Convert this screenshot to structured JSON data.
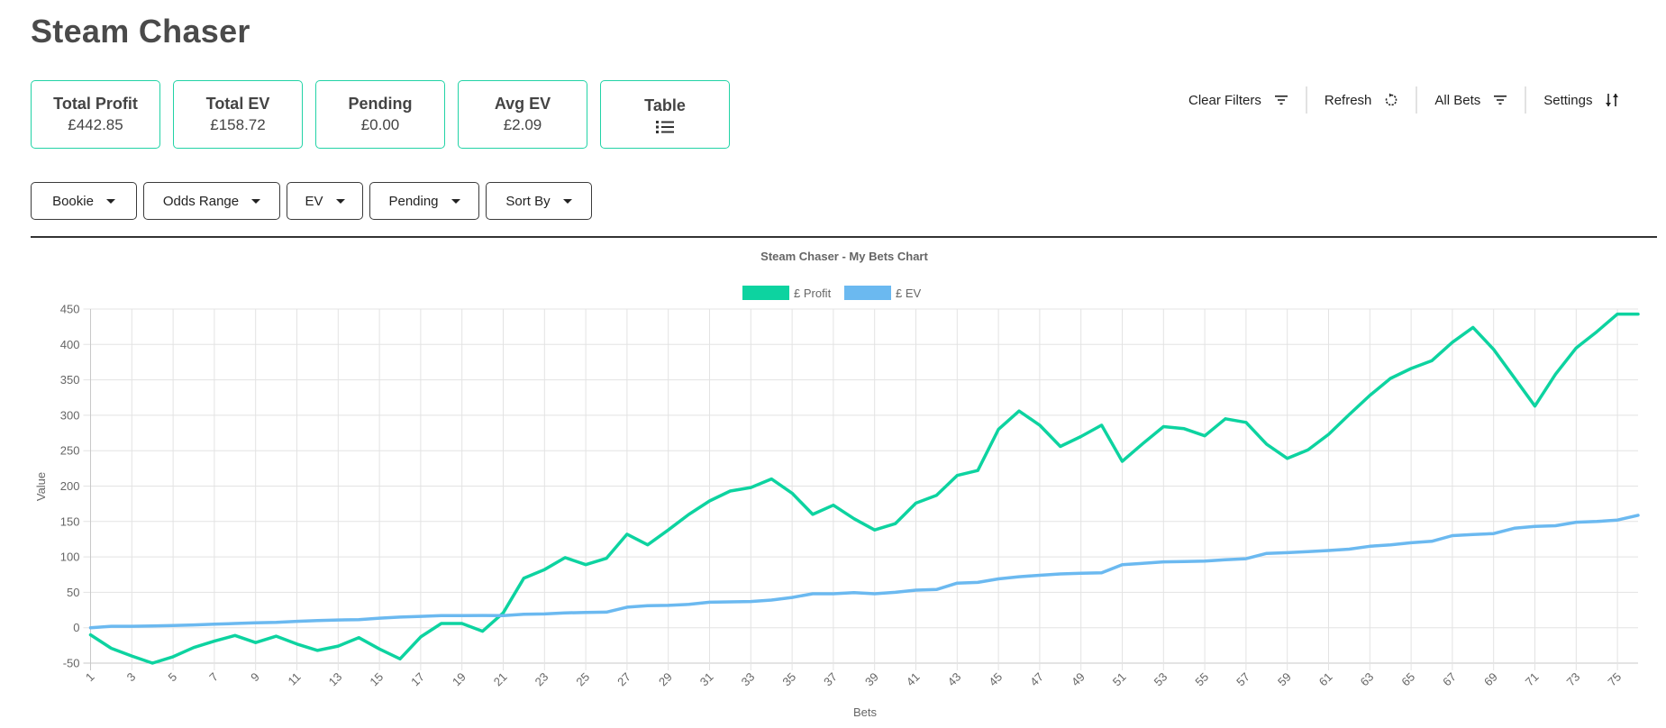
{
  "app": {
    "title": "Steam Chaser"
  },
  "cards": [
    {
      "label": "Total Profit",
      "value": "£442.85"
    },
    {
      "label": "Total EV",
      "value": "£158.72"
    },
    {
      "label": "Pending",
      "value": "£0.00"
    },
    {
      "label": "Avg EV",
      "value": "£2.09"
    },
    {
      "label": "Table",
      "icon": "list-icon"
    }
  ],
  "toolbar": [
    {
      "label": "Clear Filters",
      "icon": "filter-icon"
    },
    {
      "label": "Refresh",
      "icon": "refresh-icon"
    },
    {
      "label": "All Bets",
      "icon": "filter-icon"
    },
    {
      "label": "Settings",
      "icon": "sort-icon"
    }
  ],
  "filters": [
    {
      "label": "Bookie"
    },
    {
      "label": "Odds Range"
    },
    {
      "label": "EV"
    },
    {
      "label": "Pending"
    },
    {
      "label": "Sort By"
    }
  ],
  "colors": {
    "accent": "#22d3a6",
    "profit": "#0dd3a0",
    "ev": "#6bb9f0"
  },
  "chart_data": {
    "type": "line",
    "title": "Steam Chaser - My Bets Chart",
    "xlabel": "Bets",
    "ylabel": "Value",
    "ylim": [
      -50,
      450
    ],
    "yticks": [
      -50,
      0,
      50,
      100,
      150,
      200,
      250,
      300,
      350,
      400,
      450
    ],
    "grid": true,
    "legend_position": "top-center",
    "x": [
      1,
      2,
      3,
      4,
      5,
      6,
      7,
      8,
      9,
      10,
      11,
      12,
      13,
      14,
      15,
      16,
      17,
      18,
      19,
      20,
      21,
      22,
      23,
      24,
      25,
      26,
      27,
      28,
      29,
      30,
      31,
      32,
      33,
      34,
      35,
      36,
      37,
      38,
      39,
      40,
      41,
      42,
      43,
      44,
      45,
      46,
      47,
      48,
      49,
      50,
      51,
      52,
      53,
      54,
      55,
      56,
      57,
      58,
      59,
      60,
      61,
      62,
      63,
      64,
      65,
      66,
      67,
      68,
      69,
      70,
      71,
      72,
      73,
      74,
      75,
      76
    ],
    "xtick_labels": [
      "1",
      "3",
      "5",
      "7",
      "9",
      "11",
      "13",
      "15",
      "17",
      "19",
      "21",
      "23",
      "25",
      "27",
      "29",
      "31",
      "33",
      "35",
      "37",
      "39",
      "41",
      "43",
      "45",
      "47",
      "49",
      "51",
      "53",
      "55",
      "57",
      "59",
      "61",
      "63",
      "65",
      "67",
      "69",
      "71",
      "73",
      "75"
    ],
    "series": [
      {
        "name": "£ Profit",
        "color": "#0dd3a0",
        "values": [
          -10,
          -29,
          -40,
          -50,
          -41,
          -28,
          -19,
          -11,
          -21,
          -12,
          -23,
          -32,
          -26,
          -14,
          -30,
          -44,
          -13,
          6,
          6,
          -5,
          21,
          70,
          82,
          99,
          89,
          98,
          132,
          117,
          138,
          160,
          179,
          193,
          198,
          210,
          190,
          160,
          173,
          154,
          138,
          147,
          176,
          187,
          215,
          222,
          280,
          306,
          286,
          256,
          270,
          286,
          235,
          260,
          284,
          281,
          271,
          295,
          290,
          259,
          239,
          251,
          273,
          301,
          328,
          352,
          366,
          377,
          403,
          424,
          393,
          353,
          313,
          358,
          395,
          418,
          442.85,
          442.85
        ]
      },
      {
        "name": "£ EV",
        "color": "#6bb9f0",
        "values": [
          0,
          2,
          2,
          2.5,
          3,
          4,
          5,
          6,
          7,
          7.5,
          9,
          10,
          11,
          11.5,
          13.5,
          15,
          16,
          17,
          17,
          17.3,
          17,
          19,
          19.5,
          21,
          21.5,
          22,
          29,
          31,
          31.5,
          33,
          36,
          36.5,
          37,
          39,
          42.7,
          48,
          48,
          49.5,
          48,
          50,
          53,
          54,
          63,
          64,
          69,
          72,
          74,
          76,
          77,
          77.5,
          89,
          91,
          93,
          93.5,
          94,
          96,
          97.5,
          105,
          106,
          107.5,
          109,
          111,
          115,
          117,
          120,
          122,
          130,
          131.5,
          133,
          140.5,
          143,
          144,
          149,
          150,
          152,
          158.72
        ]
      }
    ]
  }
}
